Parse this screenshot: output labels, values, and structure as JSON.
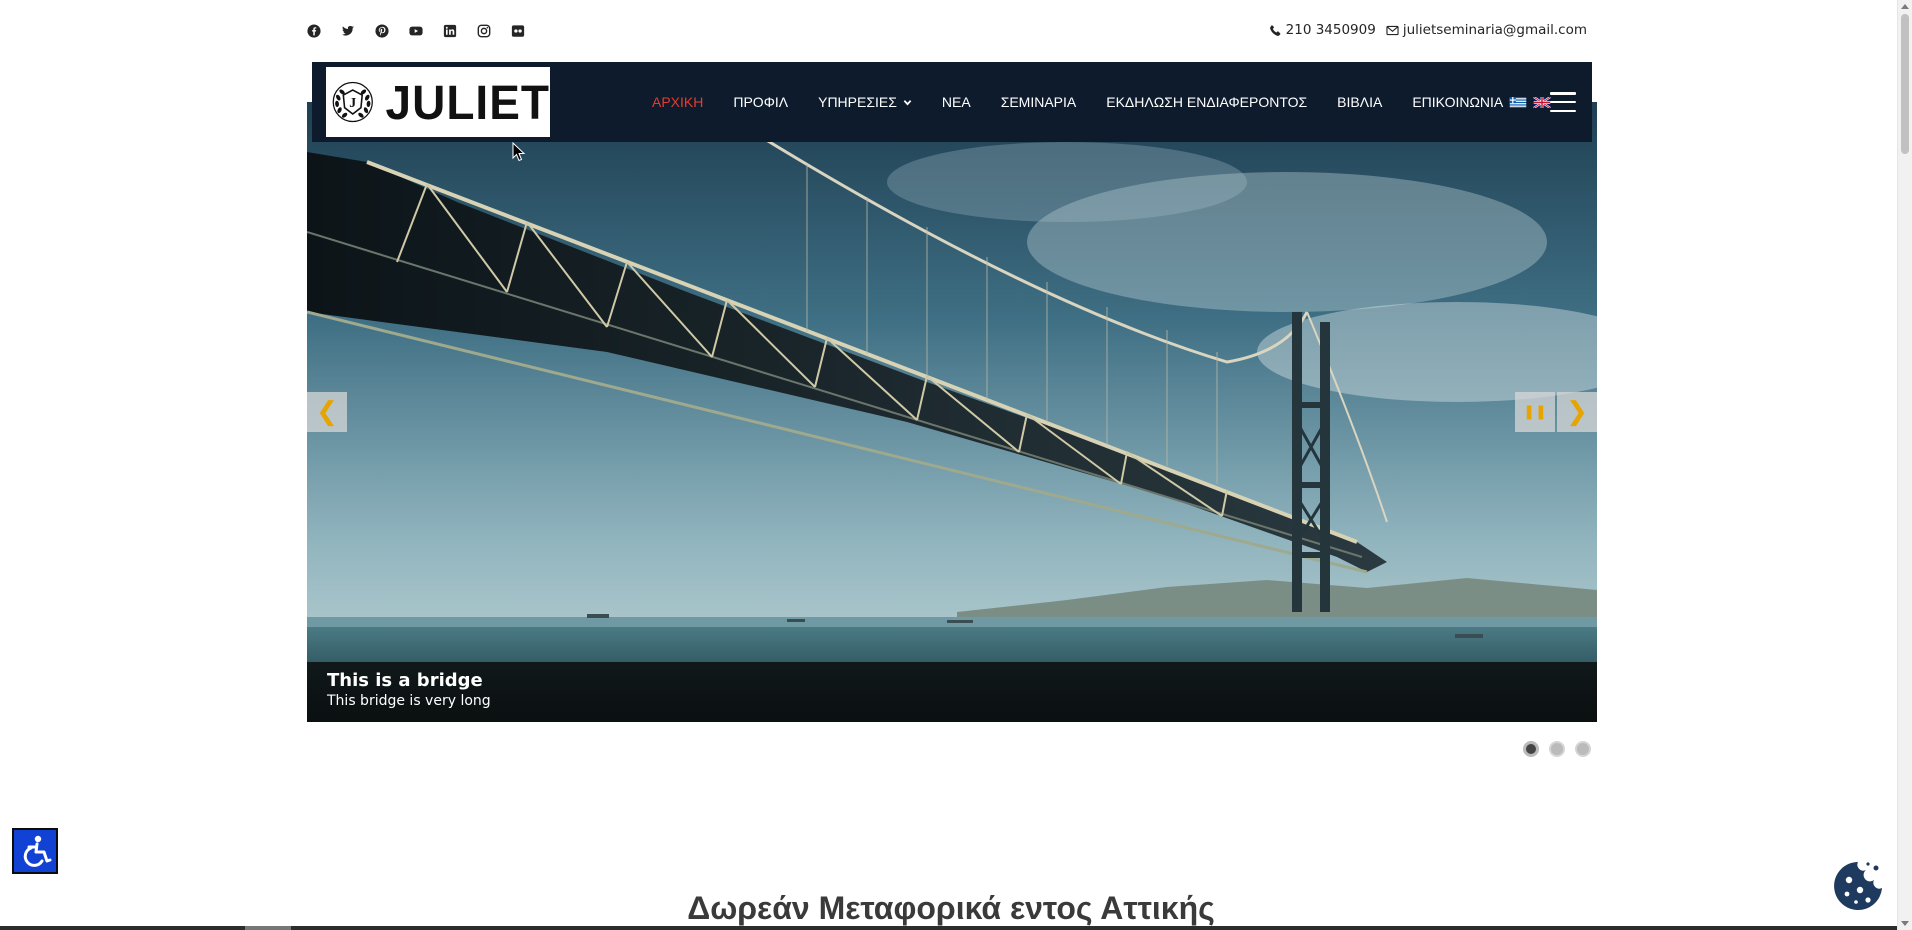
{
  "topbar": {
    "social_icons": [
      "facebook-icon",
      "twitter-icon",
      "pinterest-icon",
      "youtube-icon",
      "linkedin-icon",
      "instagram-icon",
      "flickr-icon"
    ],
    "phone": "210 3450909",
    "email": "julietseminaria@gmail.com"
  },
  "header": {
    "logo_text": "JULIET",
    "logo_emblem_letter": "J"
  },
  "nav": {
    "items": [
      {
        "label": "ΑΡΧΙΚΗ",
        "active": true
      },
      {
        "label": "ΠΡΟΦΙΛ"
      },
      {
        "label": "ΥΠΗΡΕΣΙΕΣ",
        "dropdown": true
      },
      {
        "label": "ΝΕΑ"
      },
      {
        "label": "ΣΕΜΙΝΑΡΙΑ"
      },
      {
        "label": "ΕΚΔΗΛΩΣΗ ΕΝΔΙΑΦΕΡΟΝΤΟΣ"
      },
      {
        "label": "ΒΙΒΛΙΑ"
      },
      {
        "label": "ΕΠΙΚΟΙΝΩΝΙΑ"
      }
    ],
    "active_color": "#e53b2c",
    "background": "#0e1b2c"
  },
  "slider": {
    "caption_title": "This is a bridge",
    "caption_text": "This bridge is very long",
    "prev_glyph": "❮",
    "next_glyph": "❯",
    "pause_glyph": "❚❚",
    "slides_count": 3,
    "current_slide": 1,
    "arrow_color": "#e6a400"
  },
  "main": {
    "section_title": "Δωρεάν Μεταφορικά εντος Αττικής"
  },
  "widgets": {
    "accessibility_color": "#1142d3",
    "cookie_color": "#1f3a5f"
  }
}
